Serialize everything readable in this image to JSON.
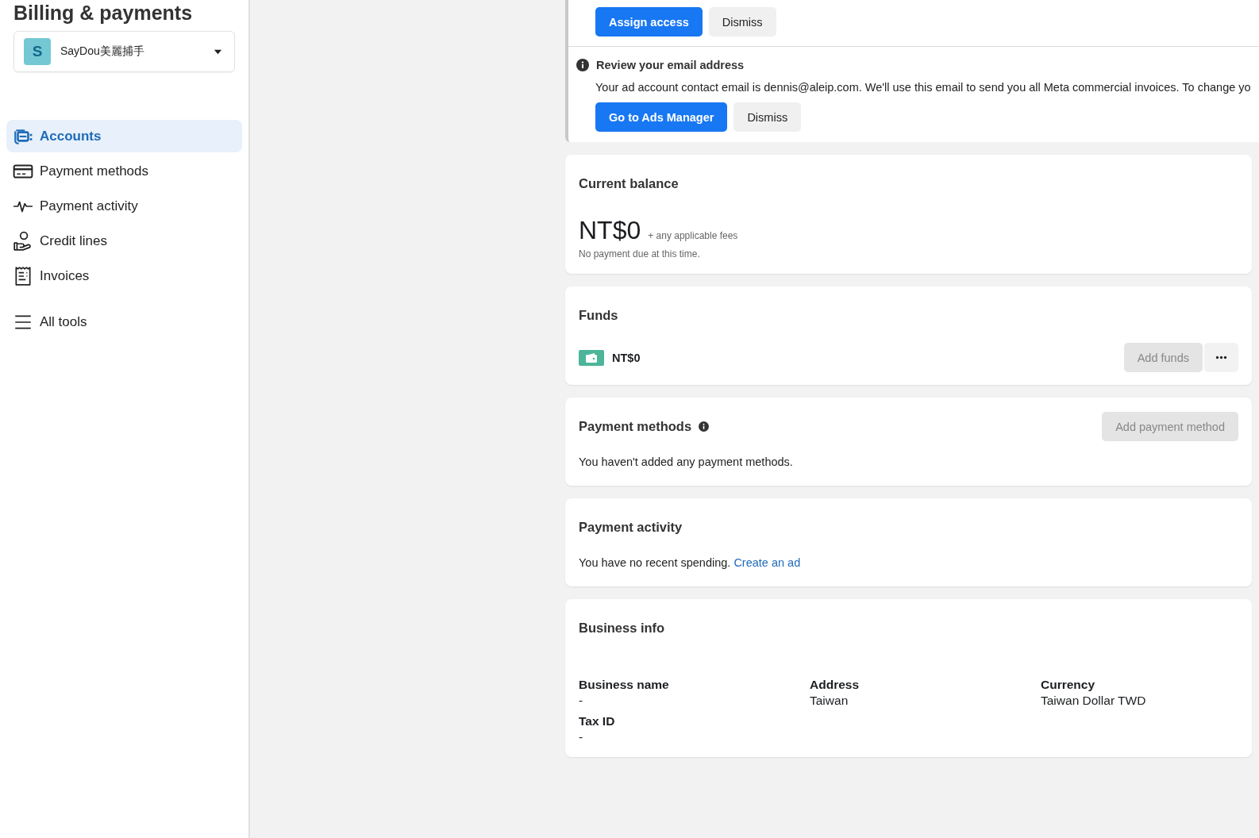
{
  "sidebar": {
    "title": "Billing & payments",
    "account": {
      "initial": "S",
      "name": "SayDou美麗捕手"
    },
    "nav": [
      {
        "label": "Accounts",
        "selected": true
      },
      {
        "label": "Payment methods",
        "selected": false
      },
      {
        "label": "Payment activity",
        "selected": false
      },
      {
        "label": "Credit lines",
        "selected": false
      },
      {
        "label": "Invoices",
        "selected": false
      },
      {
        "label": "All tools",
        "selected": false
      }
    ]
  },
  "notices": [
    {
      "buttons": [
        {
          "label": "Assign access",
          "primary": true
        },
        {
          "label": "Dismiss",
          "primary": false
        }
      ]
    },
    {
      "title": "Review your email address",
      "body": "Your ad account contact email is dennis@aleip.com. We'll use this email to send you all Meta commercial invoices. To change yo",
      "buttons": [
        {
          "label": "Go to Ads Manager",
          "primary": true
        },
        {
          "label": "Dismiss",
          "primary": false
        }
      ]
    }
  ],
  "balance": {
    "title": "Current balance",
    "amount": "NT$0",
    "fees": "+ any applicable fees",
    "note": "No payment due at this time."
  },
  "funds": {
    "title": "Funds",
    "amount": "NT$0",
    "button": {
      "label": "Add funds",
      "disabled": true
    }
  },
  "payment_methods": {
    "title": "Payment methods",
    "button": {
      "label": "Add payment method",
      "disabled": true
    },
    "empty": "You haven't added any payment methods."
  },
  "payment_activity": {
    "title": "Payment activity",
    "text": "You have no recent spending.",
    "link": "Create an ad"
  },
  "business_info": {
    "title": "Business info",
    "fields": [
      {
        "label": "Business name",
        "value": "-"
      },
      {
        "label": "Address",
        "value": "Taiwan"
      },
      {
        "label": "Currency",
        "value": "Taiwan Dollar TWD"
      },
      {
        "label": "Tax ID",
        "value": "-"
      }
    ]
  }
}
